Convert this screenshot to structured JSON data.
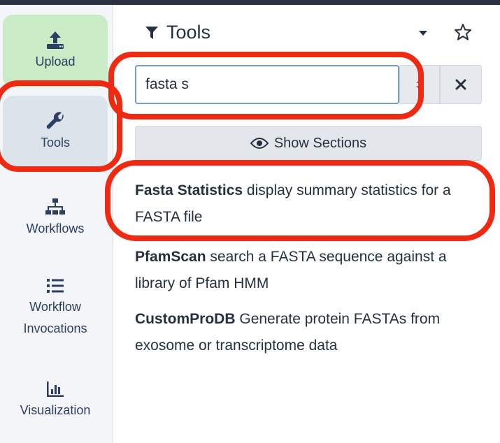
{
  "activity_bar": {
    "items": [
      {
        "label": "Upload",
        "icon": "upload-icon"
      },
      {
        "label": "Tools",
        "icon": "wrench-icon"
      },
      {
        "label": "Workflows",
        "icon": "sitemap-icon"
      },
      {
        "label": "Workflow Invocations",
        "icon": "list-icon"
      },
      {
        "label": "Visualization",
        "icon": "chart-icon"
      }
    ]
  },
  "tool_panel": {
    "title": "Tools",
    "title_icon": "filter-icon",
    "search": {
      "value": "fasta s"
    },
    "show_sections_label": "Show Sections",
    "results": [
      {
        "name": "Fasta Statistics",
        "description": "display summary statistics for a FASTA file"
      },
      {
        "name": "PfamScan",
        "description": "search a FASTA sequence against a library of Pfam HMM"
      },
      {
        "name": "CustomProDB",
        "description": "Generate protein FASTAs from exosome or transcriptome data"
      }
    ]
  },
  "colors": {
    "highlight_ring": "#ee2a13",
    "upload_bg": "#c9ebc5",
    "active_item_bg": "#dde3ea",
    "input_border": "#6f9ed1"
  }
}
